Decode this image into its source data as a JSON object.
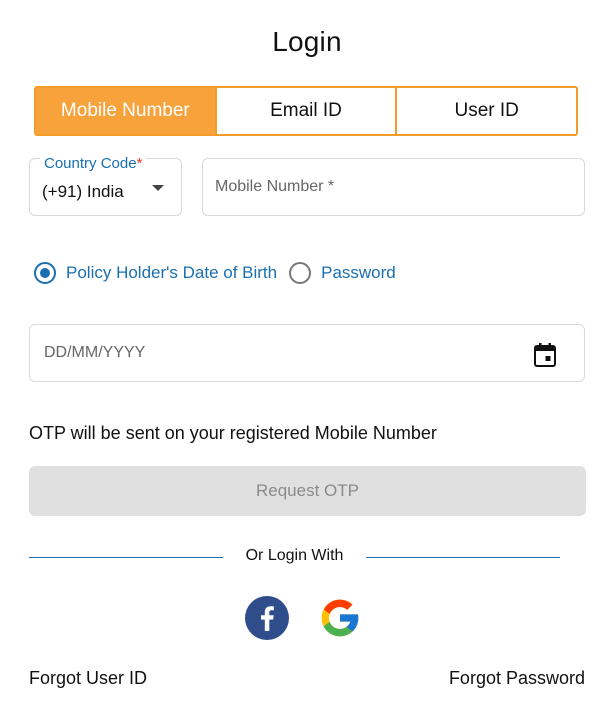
{
  "page": {
    "title": "Login"
  },
  "tabs": [
    {
      "label": "Mobile Number",
      "active": true
    },
    {
      "label": "Email ID",
      "active": false
    },
    {
      "label": "User ID",
      "active": false
    }
  ],
  "country_code": {
    "label": "Country Code",
    "required_mark": "*",
    "value": "(+91) India"
  },
  "mobile": {
    "placeholder": "Mobile Number *",
    "value": ""
  },
  "auth_options": [
    {
      "label": "Policy Holder's Date of Birth",
      "selected": true
    },
    {
      "label": "Password",
      "selected": false
    }
  ],
  "dob": {
    "placeholder": "DD/MM/YYYY",
    "icon": "calendar-icon"
  },
  "otp": {
    "note": "OTP will be sent on your registered Mobile Number",
    "button_label": "Request OTP",
    "button_enabled": false
  },
  "social": {
    "divider_text": "Or Login With",
    "providers": [
      {
        "name": "facebook-icon"
      },
      {
        "name": "google-icon"
      }
    ]
  },
  "links": {
    "forgot_user_id": "Forgot User ID",
    "forgot_password": "Forgot Password"
  },
  "colors": {
    "accent_orange": "#f7a23a",
    "link_blue": "#1a6fb0",
    "required_red": "#e0392b",
    "disabled_bg": "#e0e0e0",
    "facebook_blue": "#2f4d8a"
  }
}
